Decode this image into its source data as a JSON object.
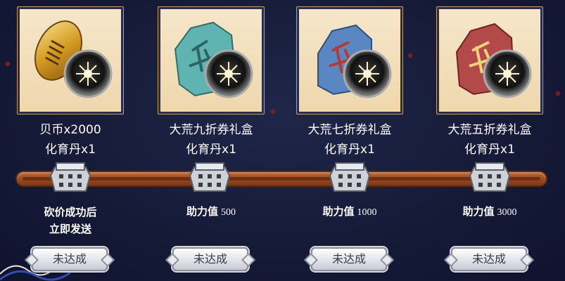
{
  "rewards": [
    {
      "line1": "贝币x2000",
      "line2": "化育丹x1",
      "item": "gold-shell-icon",
      "stone_color": "#d9a53a"
    },
    {
      "line1": "大荒九折券礼盒",
      "line2": "化育丹x1",
      "item": "teal-rune-stone-icon",
      "stone_color": "#5fb3b0"
    },
    {
      "line1": "大荒七折券礼盒",
      "line2": "化育丹x1",
      "item": "blue-rune-stone-icon",
      "stone_color": "#5a86c2"
    },
    {
      "line1": "大荒五折券礼盒",
      "line2": "化育丹x1",
      "item": "red-rune-stone-icon",
      "stone_color": "#b24a4a"
    }
  ],
  "first_note": {
    "line1": "砍价成功后",
    "line2": "立即发送"
  },
  "milestones": [
    {
      "label": "助力值",
      "value": "500"
    },
    {
      "label": "助力值",
      "value": "1000"
    },
    {
      "label": "助力值",
      "value": "3000"
    }
  ],
  "button_label": "未达成",
  "colors": {
    "background": "#1a1f3f",
    "track": "#a5552a",
    "card": "#f3dfbb",
    "button": "#e6e7ec"
  }
}
